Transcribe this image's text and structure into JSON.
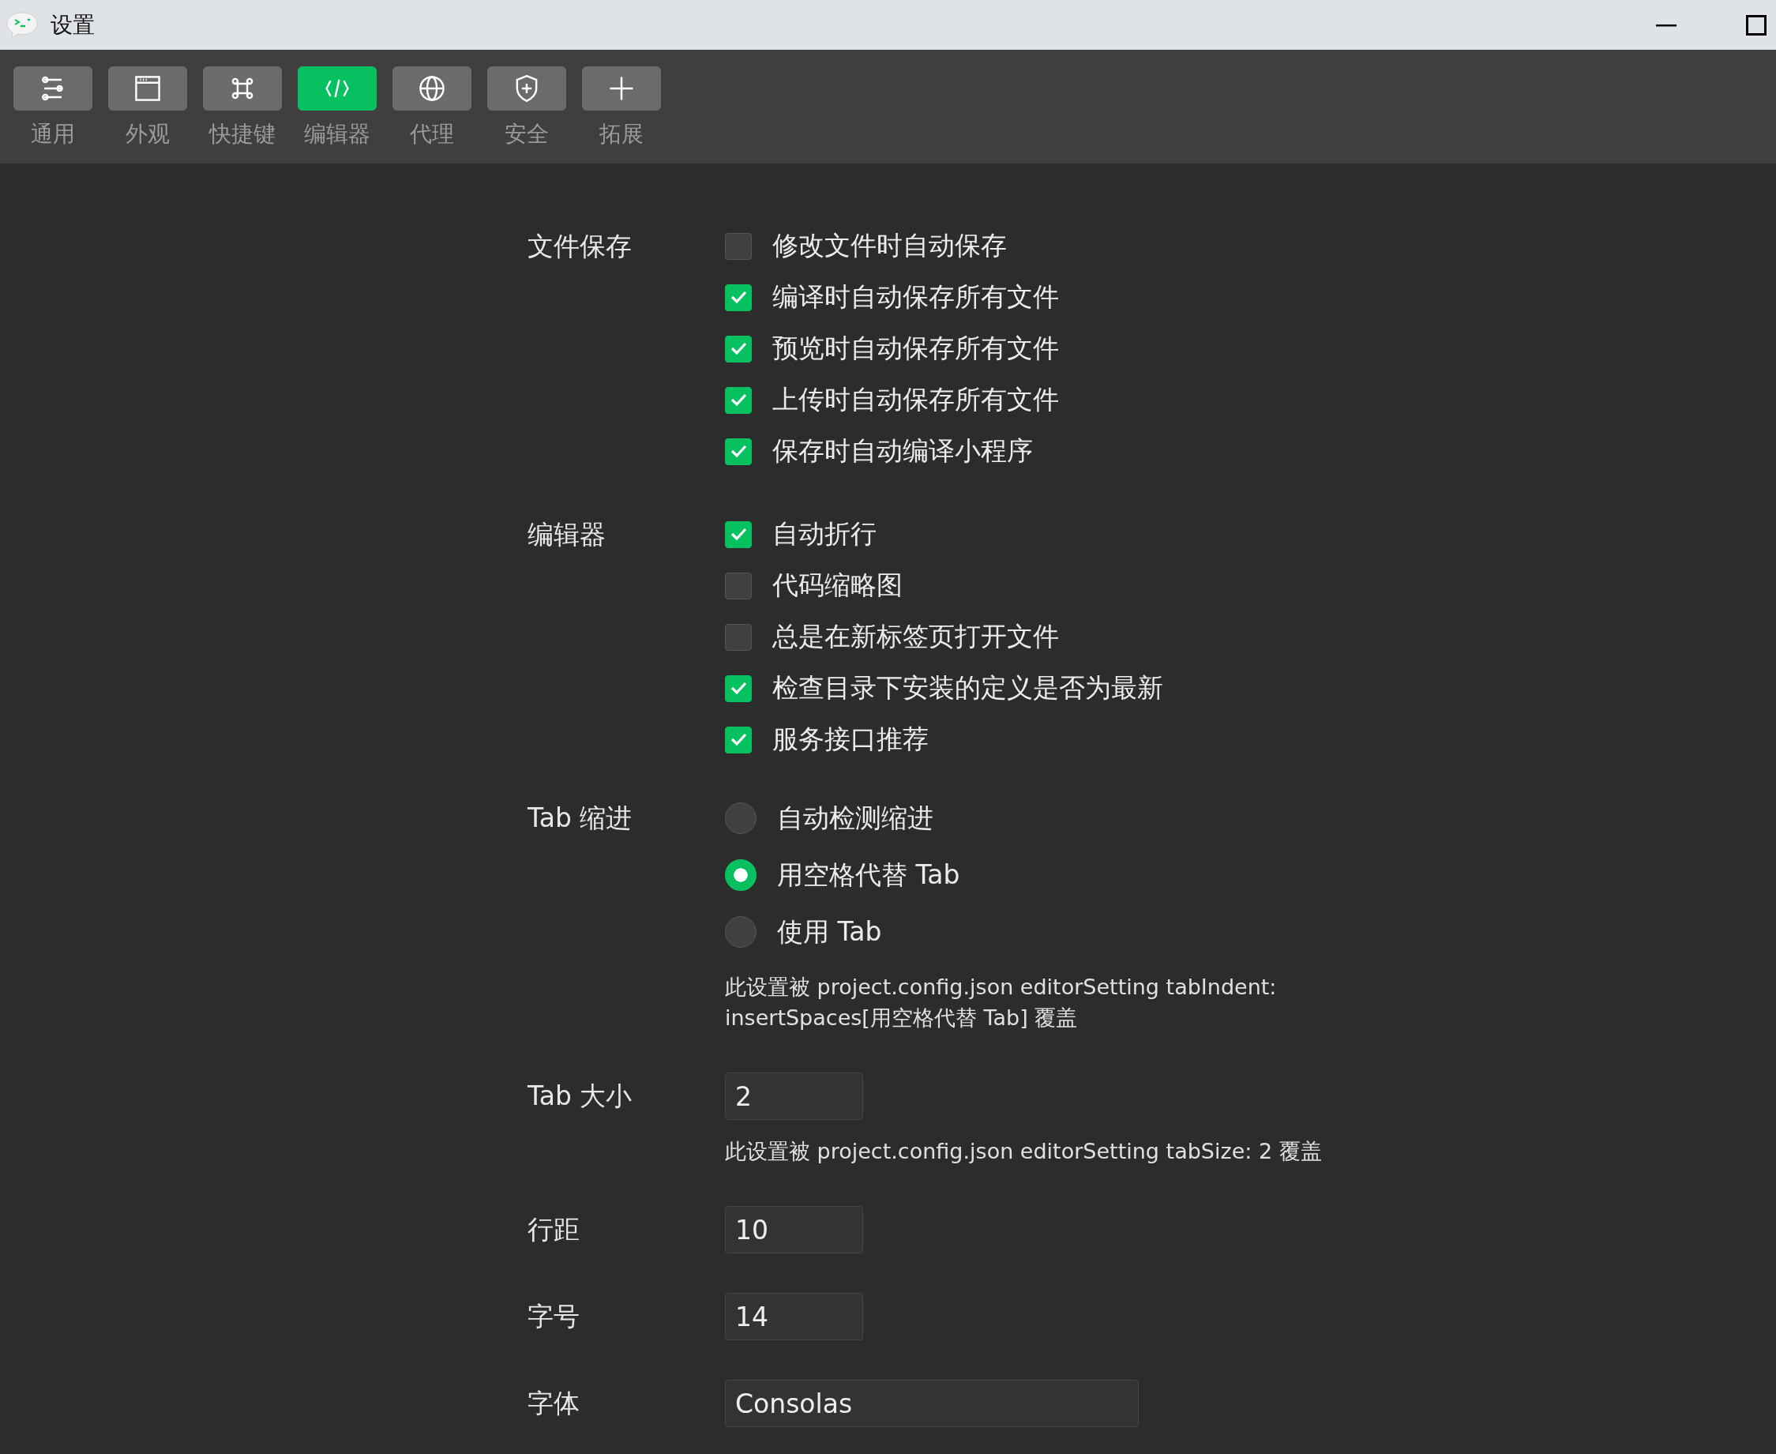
{
  "window": {
    "title": "设置"
  },
  "toolbar": [
    {
      "kind": "sliders",
      "label": "通用",
      "selected": false
    },
    {
      "kind": "window",
      "label": "外观",
      "selected": false
    },
    {
      "kind": "command",
      "label": "快捷键",
      "selected": false
    },
    {
      "kind": "code",
      "label": "编辑器",
      "selected": true
    },
    {
      "kind": "globe",
      "label": "代理",
      "selected": false
    },
    {
      "kind": "shield",
      "label": "安全",
      "selected": false
    },
    {
      "kind": "plus",
      "label": "拓展",
      "selected": false
    }
  ],
  "sections": [
    {
      "kind": "checkboxes",
      "label": "文件保存",
      "items": [
        {
          "label": "修改文件时自动保存",
          "checked": false
        },
        {
          "label": "编译时自动保存所有文件",
          "checked": true
        },
        {
          "label": "预览时自动保存所有文件",
          "checked": true
        },
        {
          "label": "上传时自动保存所有文件",
          "checked": true
        },
        {
          "label": "保存时自动编译小程序",
          "checked": true
        }
      ]
    },
    {
      "kind": "checkboxes",
      "label": "编辑器",
      "items": [
        {
          "label": "自动折行",
          "checked": true
        },
        {
          "label": "代码缩略图",
          "checked": false
        },
        {
          "label": "总是在新标签页打开文件",
          "checked": false
        },
        {
          "label": "检查目录下安装的定义是否为最新",
          "checked": true
        },
        {
          "label": "服务接口推荐",
          "checked": true
        }
      ]
    },
    {
      "kind": "radios",
      "label": "Tab 缩进",
      "options": [
        {
          "label": "自动检测缩进",
          "selected": false
        },
        {
          "label": "用空格代替 Tab",
          "selected": true
        },
        {
          "label": "使用 Tab",
          "selected": false
        }
      ],
      "note": "此设置被 project.config.json editorSetting tabIndent: insertSpaces[用空格代替 Tab] 覆盖"
    },
    {
      "kind": "input",
      "label": "Tab 大小",
      "value": "2",
      "note": "此设置被 project.config.json editorSetting tabSize: 2 覆盖"
    },
    {
      "kind": "input",
      "label": "行距",
      "value": "10"
    },
    {
      "kind": "input",
      "label": "字号",
      "value": "14"
    },
    {
      "kind": "wide-input",
      "label": "字体",
      "value": "Consolas"
    }
  ]
}
